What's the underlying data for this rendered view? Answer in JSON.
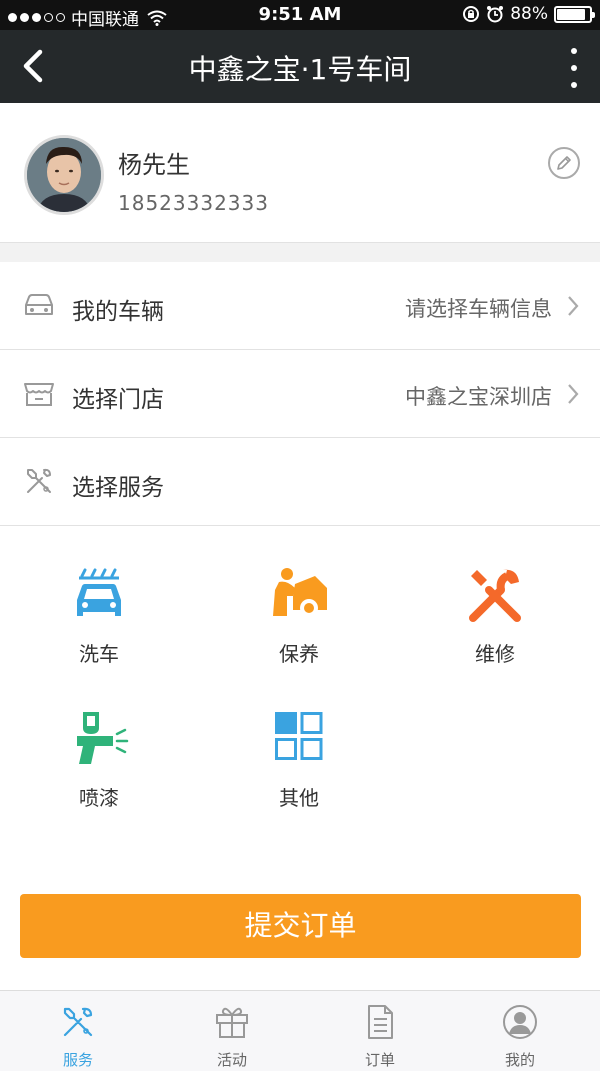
{
  "status_bar": {
    "carrier": "中国联通",
    "time": "9:51 AM",
    "battery_percent": "88%",
    "battery_level": 0.88
  },
  "nav": {
    "title": "中鑫之宝·1号车间",
    "back_icon": "chevron-left-icon",
    "more_icon": "more-vertical-icon"
  },
  "profile": {
    "name": "杨先生",
    "phone": "18523332333",
    "edit_icon": "pencil-icon"
  },
  "rows": [
    {
      "label": "我的车辆",
      "value": "请选择车辆信息",
      "icon": "car-icon"
    },
    {
      "label": "选择门店",
      "value": "中鑫之宝深圳店",
      "icon": "store-icon"
    },
    {
      "label": "选择服务",
      "value": "",
      "icon": "tools-icon"
    }
  ],
  "services": [
    {
      "label": "洗车",
      "icon": "car-wash-icon"
    },
    {
      "label": "保养",
      "icon": "maintenance-icon"
    },
    {
      "label": "维修",
      "icon": "repair-icon"
    },
    {
      "label": "喷漆",
      "icon": "spray-gun-icon"
    },
    {
      "label": "其他",
      "icon": "grid-icon"
    }
  ],
  "submit_label": "提交订单",
  "tabs": [
    {
      "label": "服务",
      "icon": "tools-icon",
      "active": true
    },
    {
      "label": "活动",
      "icon": "gift-icon",
      "active": false
    },
    {
      "label": "订单",
      "icon": "document-icon",
      "active": false
    },
    {
      "label": "我的",
      "icon": "user-icon",
      "active": false
    }
  ],
  "colors": {
    "nav_bg": "#25292b",
    "accent_orange": "#f99b1f",
    "accent_blue": "#3aa3e0",
    "icon_green": "#2fb37a"
  }
}
